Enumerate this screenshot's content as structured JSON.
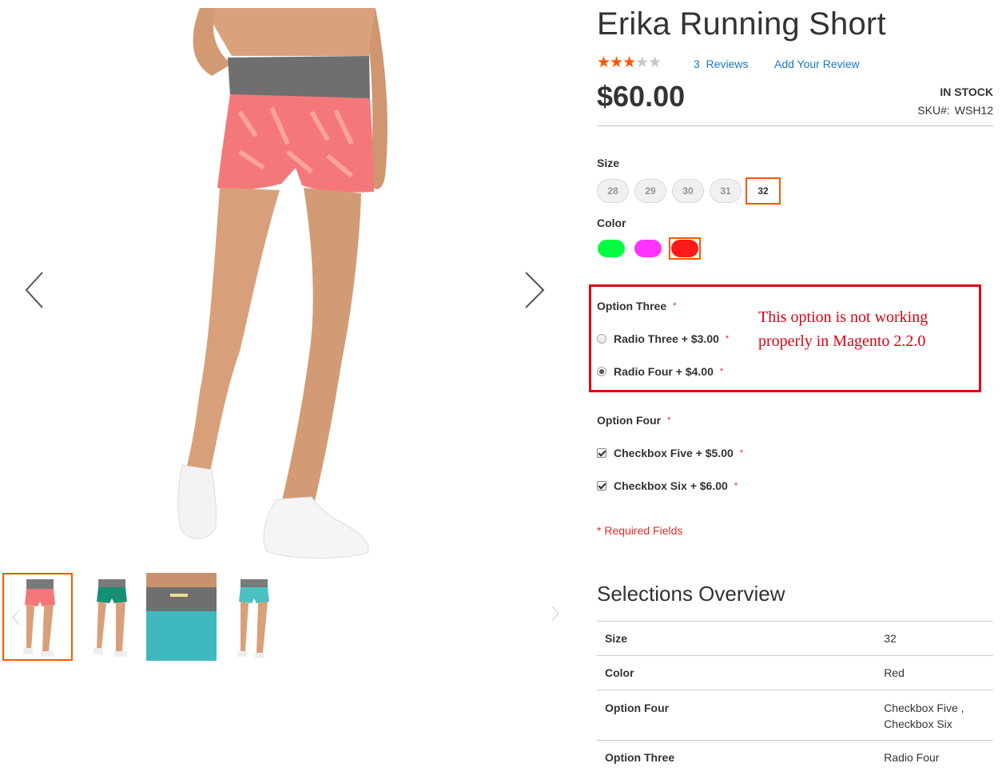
{
  "gallery": {
    "prev_icon": "chevron-left-icon",
    "next_icon": "chevron-right-icon",
    "thumbnails": [
      {
        "label": "pink shorts front view",
        "active": true
      },
      {
        "label": "green shorts front view",
        "active": false
      },
      {
        "label": "waistband close-up",
        "active": false
      },
      {
        "label": "teal shorts front view",
        "active": false
      }
    ]
  },
  "product": {
    "title": "Erika Running Short",
    "rating_percent": 60,
    "reviews_count": "3",
    "reviews_text": "Reviews",
    "add_review": "Add Your Review",
    "price": "$60.00",
    "stock": "In stock",
    "sku_label": "SKU#:",
    "sku_value": "WSH12"
  },
  "size": {
    "label": "Size",
    "options": [
      "28",
      "29",
      "30",
      "31",
      "32"
    ],
    "selected": "32"
  },
  "color": {
    "label": "Color",
    "options": [
      {
        "name": "Green",
        "hex": "#00ff40"
      },
      {
        "name": "Magenta",
        "hex": "#ff33ff"
      },
      {
        "name": "Red",
        "hex": "#ff1a1a"
      }
    ],
    "selected": "Red"
  },
  "option_three": {
    "label": "Option Three",
    "required_mark": "*",
    "choices": [
      {
        "text": "Radio Three + $3.00",
        "checked": false
      },
      {
        "text": "Radio Four + $4.00",
        "checked": true
      }
    ]
  },
  "annotation": {
    "text": "This option is not working properly in Magento 2.2.0",
    "color": "#e00012"
  },
  "option_four": {
    "label": "Option Four",
    "required_mark": "*",
    "choices": [
      {
        "text": "Checkbox Five + $5.00",
        "checked": true
      },
      {
        "text": "Checkbox Six + $6.00",
        "checked": true
      }
    ]
  },
  "required_fields": "* Required Fields",
  "summary": {
    "title": "Selections Overview",
    "rows": [
      {
        "key": "Size",
        "value": "32"
      },
      {
        "key": "Color",
        "value": "Red"
      },
      {
        "key": "Option Four",
        "value": "Checkbox Five , Checkbox Six"
      },
      {
        "key": "Option Three",
        "value": "Radio Four"
      }
    ]
  },
  "colors": {
    "accent": "#ff5501",
    "link": "#1979c3",
    "required": "#e02b27"
  }
}
